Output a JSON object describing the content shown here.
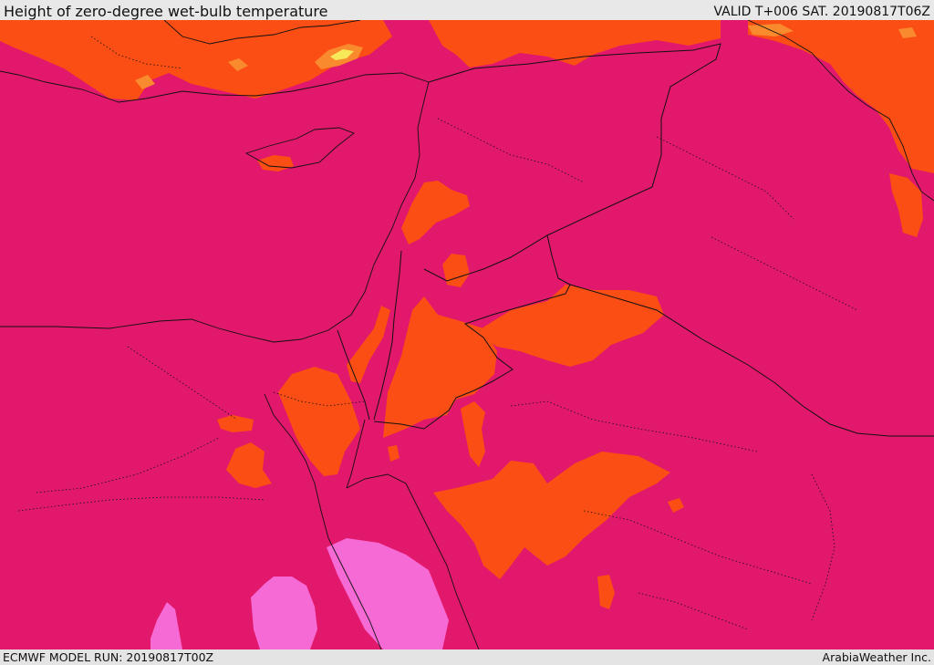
{
  "header": {
    "title": "Height of zero-degree wet-bulb temperature",
    "valid": "VALID T+006 SAT. 20190817T06Z"
  },
  "footer": {
    "model_run": "ECMWF MODEL RUN: 20190817T00Z",
    "credit": "ArabiaWeather Inc."
  },
  "colors": {
    "base": "#e2186c",
    "orange": "#fb4e14",
    "light_orange": "#fa8a2e",
    "yellow": "#f7e85a",
    "pink": "#f56ad4",
    "border": "#111111"
  }
}
